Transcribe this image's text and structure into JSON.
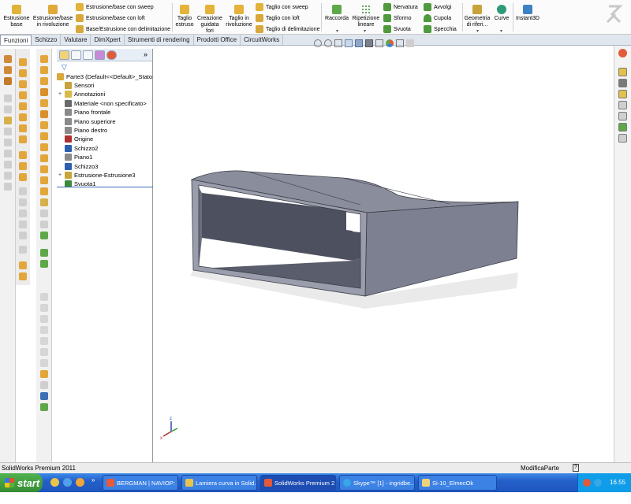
{
  "ribbon": {
    "extrude_boss": "Estrusione base",
    "revolve_boss_1": "Estrusione/base",
    "revolve_boss_2": "in rivoluzione",
    "sweep_boss": "Estrusione/base con sweep",
    "loft_boss": "Estrusione/base con loft",
    "boundary_boss": "Base/Estrusione con delimitazione",
    "extruded_cut_1": "Taglio",
    "extruded_cut_2": "estruso",
    "hole_wizard_1": "Creazione",
    "hole_wizard_2": "guidata",
    "hole_wizard_3": "fori",
    "revolved_cut_1": "Taglio in",
    "revolved_cut_2": "rivoluzione",
    "swept_cut": "Taglio con sweep",
    "lofted_cut": "Taglio con loft",
    "boundary_cut": "Taglio di delimitazione",
    "fillet": "Raccorda",
    "linear_pattern_1": "Ripetizione",
    "linear_pattern_2": "lineare",
    "rib": "Nervatura",
    "draft": "Sformo",
    "shell": "Svuota",
    "wrap": "Avvolgi",
    "dome": "Cupola",
    "mirror": "Specchia",
    "ref_geom_1": "Geometria",
    "ref_geom_2": "di riferi...",
    "curves": "Curve",
    "instant3d": "Instant3D"
  },
  "tabs": [
    "Funzioni",
    "Schizzo",
    "Valutare",
    "DimXpert",
    "Strumenti di rendering",
    "Prodotti Office",
    "CircuitWorks"
  ],
  "tree": {
    "root": "Parte3  (Default<<Default>_Stato",
    "items": [
      {
        "label": "Sensori",
        "expand": "",
        "color": "#c9a23a"
      },
      {
        "label": "Annotazioni",
        "expand": "+",
        "color": "#d9b94a"
      },
      {
        "label": "Materiale <non specificato>",
        "expand": "",
        "color": "#6a6a6a"
      },
      {
        "label": "Piano frontale",
        "expand": "",
        "color": "#8a8a8a"
      },
      {
        "label": "Piano superiore",
        "expand": "",
        "color": "#8a8a8a"
      },
      {
        "label": "Piano destro",
        "expand": "",
        "color": "#8a8a8a"
      },
      {
        "label": "Origine",
        "expand": "",
        "color": "#b03030"
      },
      {
        "label": "Schizzo2",
        "expand": "",
        "color": "#2d5fb0"
      },
      {
        "label": "Piano1",
        "expand": "",
        "color": "#8a8a8a"
      },
      {
        "label": "Schizzo3",
        "expand": "",
        "color": "#2d5fb0"
      },
      {
        "label": "Estrusione-Estrusione3",
        "expand": "+",
        "color": "#c7a63a"
      },
      {
        "label": "Svuota1",
        "expand": "",
        "color": "#3d8a3d"
      }
    ]
  },
  "triad": {
    "z": "z",
    "x": "x"
  },
  "status": {
    "left": "SolidWorks Premium 2011",
    "right": "ModificaParte",
    "help": "?"
  },
  "taskbar": {
    "start": "start",
    "buttons": [
      "BERGMAN | NAVIOP: ...",
      "Lamiera curva in Solid...",
      "SolidWorks Premium 2...",
      "Skype™ [1] - ingridbe...",
      "Si-10_ElmecOk"
    ],
    "clock": "16.55"
  }
}
